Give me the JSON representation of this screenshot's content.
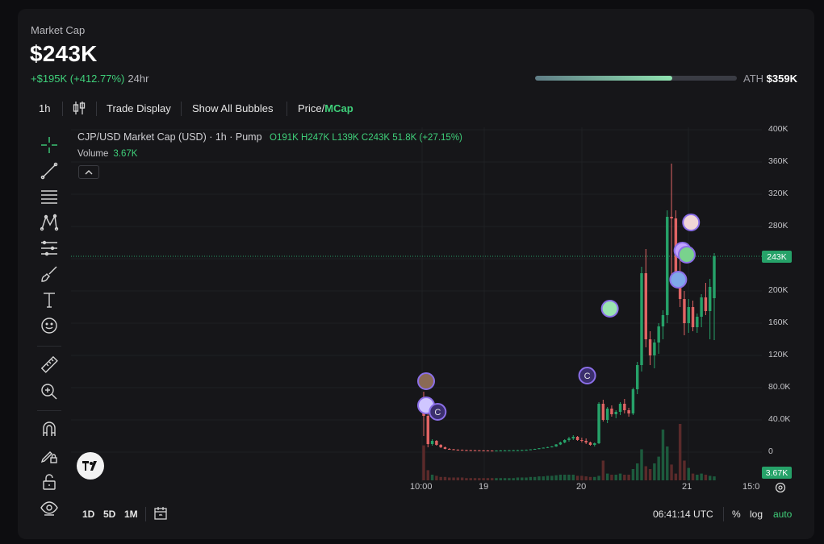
{
  "market_cap": {
    "label": "Market Cap",
    "value": "$243K",
    "change": "+$195K (+412.77%)",
    "period": "24hr",
    "ath_label": "ATH",
    "ath_value": "$359K",
    "ath_progress_fraction": 0.68
  },
  "toolbar": {
    "interval": "1h",
    "candles_icon": "candlestick-icon",
    "trade_display": "Trade Display",
    "show_all_bubbles": "Show All Bubbles",
    "price_label": "Price",
    "slash": "/",
    "mcap_label": "MCap"
  },
  "sidebar": {
    "tools": [
      "crosshair-icon",
      "trendline-icon",
      "fib-lines-icon",
      "pattern-icon",
      "projection-icon",
      "brush-icon",
      "text-icon",
      "emoji-icon",
      "ruler-icon",
      "zoom-in-icon",
      "magnet-icon",
      "lock-drawing-icon",
      "lock-icon",
      "eye-icon"
    ]
  },
  "chart": {
    "title": "CJP/USD Market Cap (USD) · 1h · Pump",
    "open_label": "O",
    "open": "191K",
    "high_label": "H",
    "high": "247K",
    "low_label": "L",
    "low": "139K",
    "close_label": "C",
    "close": "243K",
    "change": "51.8K (+27.15%)",
    "volume_label": "Volume",
    "volume_value": "3.67K",
    "price_tag": "243K",
    "volume_tag": "3.67K",
    "up_color": "#26a269",
    "down_color": "#e06464"
  },
  "chart_data": {
    "type": "candlestick",
    "title": "CJP/USD Market Cap (USD)",
    "y_ticks": [
      "400K",
      "360K",
      "320K",
      "280K",
      "240K",
      "200K",
      "160K",
      "120K",
      "80.0K",
      "40.0K",
      "0"
    ],
    "ylim": [
      0,
      400000
    ],
    "x_ticks": [
      "10:00",
      "19",
      "20",
      "21",
      "15:0"
    ],
    "last_price": 243000,
    "ohlc_last": {
      "open": 191000,
      "high": 247000,
      "low": 139000,
      "close": 243000
    },
    "candles": [
      [
        52000,
        75000,
        20000,
        45000
      ],
      [
        45000,
        48000,
        6000,
        10000
      ],
      [
        10000,
        16000,
        8000,
        14000
      ],
      [
        14000,
        15000,
        8000,
        9000
      ],
      [
        9000,
        10000,
        5000,
        6000
      ],
      [
        6000,
        7000,
        3500,
        4000
      ],
      [
        4000,
        5000,
        3000,
        3500
      ],
      [
        3500,
        4000,
        2500,
        3000
      ],
      [
        3000,
        3500,
        2500,
        2800
      ],
      [
        2800,
        3200,
        2300,
        2500
      ],
      [
        2500,
        3000,
        2200,
        2400
      ],
      [
        2400,
        2800,
        2000,
        2300
      ],
      [
        2300,
        2700,
        2000,
        2200
      ],
      [
        2200,
        2600,
        1900,
        2100
      ],
      [
        2100,
        2500,
        1800,
        2000
      ],
      [
        2000,
        2400,
        1800,
        1900
      ],
      [
        1900,
        2300,
        1700,
        1800
      ],
      [
        1800,
        2300,
        1700,
        1900
      ],
      [
        1900,
        2400,
        1800,
        2000
      ],
      [
        2000,
        2500,
        1800,
        2100
      ],
      [
        2100,
        2600,
        1900,
        2200
      ],
      [
        2200,
        2700,
        2000,
        2300
      ],
      [
        2300,
        2800,
        2100,
        2400
      ],
      [
        2400,
        3000,
        2200,
        2600
      ],
      [
        2600,
        3200,
        2400,
        2800
      ],
      [
        2800,
        3600,
        2600,
        3400
      ],
      [
        3400,
        4200,
        3100,
        4000
      ],
      [
        4000,
        5000,
        3700,
        4800
      ],
      [
        4800,
        5800,
        4500,
        5500
      ],
      [
        5500,
        6600,
        5000,
        6200
      ],
      [
        6200,
        7500,
        5800,
        7000
      ],
      [
        7000,
        10000,
        6500,
        9500
      ],
      [
        9500,
        13000,
        8800,
        12000
      ],
      [
        12000,
        16000,
        11000,
        15000
      ],
      [
        15000,
        19000,
        13000,
        17000
      ],
      [
        17000,
        21000,
        15000,
        19000
      ],
      [
        19000,
        20000,
        14000,
        15000
      ],
      [
        15000,
        18000,
        12000,
        14000
      ],
      [
        14000,
        17000,
        10000,
        12000
      ],
      [
        12000,
        13000,
        8000,
        9000
      ],
      [
        9000,
        12000,
        7000,
        11000
      ],
      [
        11000,
        62000,
        10000,
        60000
      ],
      [
        60000,
        65000,
        38000,
        40000
      ],
      [
        40000,
        56000,
        36000,
        54000
      ],
      [
        54000,
        58000,
        44000,
        47000
      ],
      [
        47000,
        52000,
        42000,
        50000
      ],
      [
        50000,
        62000,
        46000,
        60000
      ],
      [
        60000,
        66000,
        48000,
        52000
      ],
      [
        52000,
        55000,
        44000,
        48000
      ],
      [
        48000,
        80000,
        46000,
        78000
      ],
      [
        78000,
        112000,
        72000,
        108000
      ],
      [
        108000,
        230000,
        100000,
        222000
      ],
      [
        222000,
        252000,
        130000,
        140000
      ],
      [
        140000,
        150000,
        108000,
        120000
      ],
      [
        120000,
        140000,
        104000,
        136000
      ],
      [
        136000,
        160000,
        122000,
        156000
      ],
      [
        156000,
        176000,
        140000,
        170000
      ],
      [
        170000,
        300000,
        160000,
        292000
      ],
      [
        292000,
        358000,
        210000,
        290000
      ],
      [
        290000,
        300000,
        210000,
        220000
      ],
      [
        220000,
        240000,
        180000,
        190000
      ],
      [
        190000,
        200000,
        145000,
        160000
      ],
      [
        160000,
        190000,
        148000,
        180000
      ],
      [
        180000,
        188000,
        150000,
        155000
      ],
      [
        155000,
        172000,
        148000,
        168000
      ],
      [
        168000,
        196000,
        155000,
        192000
      ],
      [
        192000,
        210000,
        170000,
        175000
      ],
      [
        175000,
        215000,
        140000,
        205000
      ],
      [
        191000,
        247000,
        139000,
        243000
      ]
    ],
    "volume": [
      0.62,
      0.18,
      0.1,
      0.08,
      0.06,
      0.06,
      0.05,
      0.05,
      0.05,
      0.05,
      0.04,
      0.04,
      0.04,
      0.04,
      0.04,
      0.04,
      0.04,
      0.04,
      0.04,
      0.04,
      0.04,
      0.04,
      0.05,
      0.05,
      0.05,
      0.06,
      0.06,
      0.07,
      0.07,
      0.08,
      0.08,
      0.09,
      0.1,
      0.1,
      0.1,
      0.1,
      0.08,
      0.08,
      0.07,
      0.06,
      0.06,
      0.08,
      0.35,
      0.12,
      0.1,
      0.1,
      0.12,
      0.1,
      0.1,
      0.2,
      0.3,
      0.55,
      0.25,
      0.2,
      0.3,
      0.42,
      0.9,
      0.6,
      0.28,
      0.12,
      1.0,
      0.35,
      0.22,
      0.12,
      0.1,
      0.12,
      0.1,
      0.08,
      0.07
    ],
    "grid": true
  }
}
